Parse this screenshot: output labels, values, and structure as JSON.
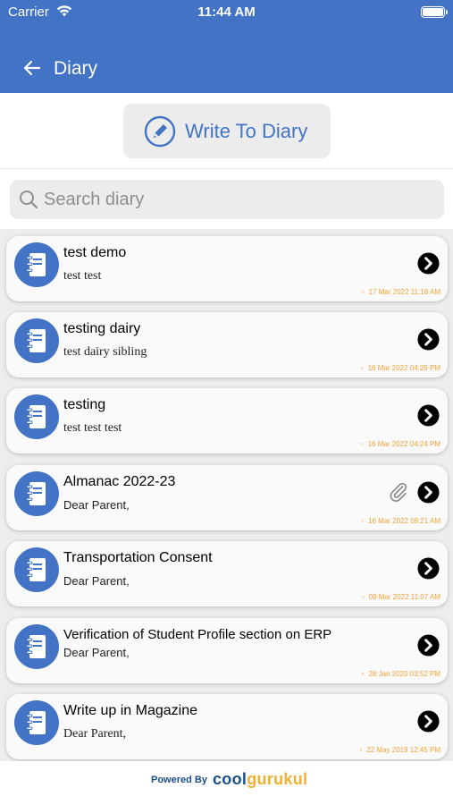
{
  "status_bar": {
    "carrier": "Carrier",
    "time": "11:44 AM"
  },
  "header": {
    "title": "Diary",
    "back_icon": "back-arrow-icon",
    "color": "#4273c4"
  },
  "write_button": {
    "label": "Write To Diary",
    "icon": "pencil-circle-icon"
  },
  "search": {
    "placeholder": "Search diary",
    "value": ""
  },
  "entries": [
    {
      "title": "test demo",
      "subtitle": "test test",
      "date": "17 Mar 2022 11:18 AM",
      "has_attachment": false,
      "serif": true
    },
    {
      "title": "testing dairy",
      "subtitle": "test dairy sibling",
      "date": "16 Mar 2022 04:29 PM",
      "has_attachment": false,
      "serif": true
    },
    {
      "title": "testing",
      "subtitle": "test test test",
      "date": "16 Mar 2022 04:24 PM",
      "has_attachment": false,
      "serif": true
    },
    {
      "title": "Almanac 2022-23",
      "subtitle": "Dear Parent,",
      "date": "16 Mar 2022 09:21 AM",
      "has_attachment": true,
      "serif": false
    },
    {
      "title": "Transportation Consent",
      "subtitle": "Dear Parent,",
      "date": "09 Mar 2022 11:07 AM",
      "has_attachment": false,
      "serif": false
    },
    {
      "title": "Verification of Student Profile section on ERP",
      "subtitle": "Dear Parent,",
      "date": "28 Jan 2020 03:52 PM",
      "has_attachment": false,
      "serif": false
    },
    {
      "title": "Write up in Magazine",
      "subtitle": "Dear Parent,",
      "date": "22 May 2019 12:45 PM",
      "has_attachment": false,
      "serif": true
    }
  ],
  "footer": {
    "powered_by": "Powered By",
    "brand_part1": "cool",
    "brand_part2": "gurukul"
  },
  "colors": {
    "accent": "#4273c4",
    "date": "#f2a134",
    "brand_blue": "#1a4e86",
    "brand_yellow": "#f0b030"
  }
}
